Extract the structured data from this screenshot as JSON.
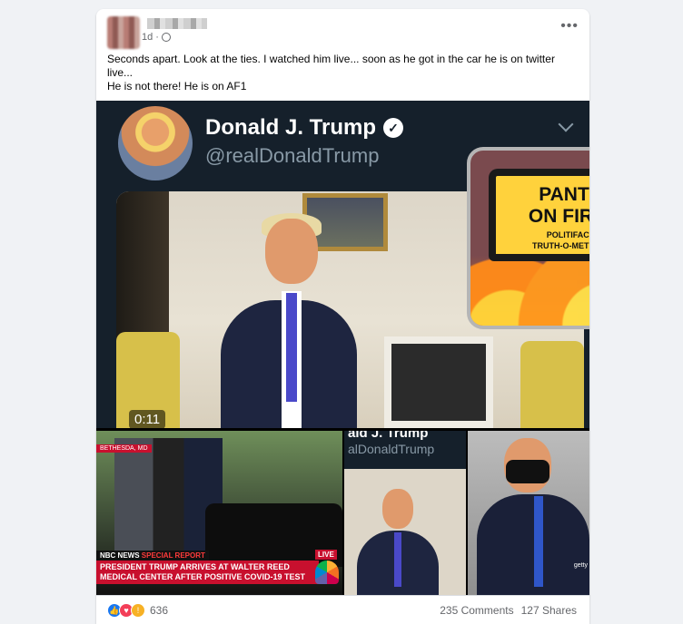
{
  "post": {
    "timestamp": "1d",
    "more_icon": "•••",
    "text_lines": [
      "Seconds apart. Look at the ties. I watched him live... soon as he got in the car he is on twitter live...",
      "He is not there! He is on AF1"
    ]
  },
  "video": {
    "tweet_name": "Donald J. Trump",
    "tweet_handle": "@realDonaldTrump",
    "verified_icon": "✓",
    "duration": "0:11"
  },
  "fact_check_badge": {
    "line1": "PANTS",
    "line2": "ON FIRE!",
    "line3": "POLITIFACT",
    "line4": "TRUTH-O-METER™"
  },
  "news_tile": {
    "location_tag": "BETHESDA, MD",
    "network_label": "NBC NEWS",
    "special_report": "SPECIAL REPORT",
    "headline": "PRESIDENT TRUMP ARRIVES AT WALTER REED MEDICAL CENTER AFTER POSITIVE COVID-19 TEST",
    "live": "LIVE"
  },
  "tweet_tile": {
    "name_partial": "ald J. Trump",
    "handle_partial": "alDonaldTrump"
  },
  "photo_tile": {
    "credit": "getty"
  },
  "footer": {
    "reaction_count": "636",
    "comments": "235 Comments",
    "shares": "127 Shares"
  },
  "colors": {
    "accent": "#1877f2",
    "twitter_bg": "#15202b",
    "news_red": "#c8102e"
  }
}
